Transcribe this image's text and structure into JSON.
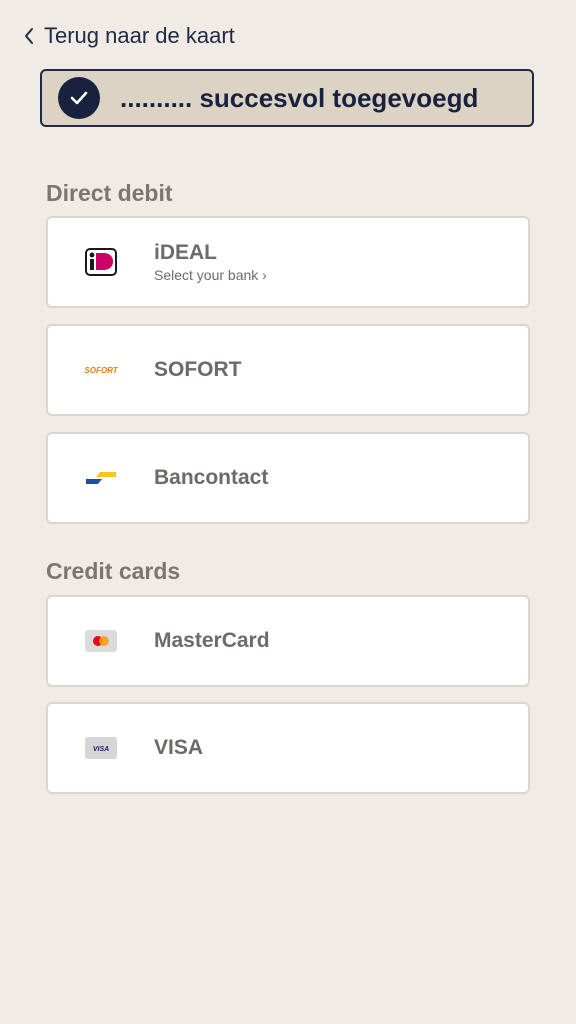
{
  "header": {
    "back_label": "Terug naar de kaart"
  },
  "toast": {
    "message": ".......... succesvol toegevoegd"
  },
  "sections": {
    "direct_debit": {
      "title": "Direct debit",
      "ideal": {
        "name": "iDEAL",
        "sub": "Select your bank ›",
        "icon": "ideal-logo"
      },
      "sofort": {
        "name": "SOFORT",
        "icon": "sofort-logo",
        "logo_text": "SOFORT"
      },
      "bancontact": {
        "name": "Bancontact",
        "icon": "bancontact-logo"
      }
    },
    "credit_cards": {
      "title": "Credit cards",
      "mastercard": {
        "name": "MasterCard",
        "icon": "mastercard-logo"
      },
      "visa": {
        "name": "VISA",
        "icon": "visa-logo",
        "logo_text": "VISA"
      }
    }
  },
  "colors": {
    "background": "#f0ebe4",
    "navy": "#18223f",
    "toast_bg": "#ddd3c5",
    "muted_text": "#6e6a65",
    "card_border": "#dcd6ce"
  }
}
